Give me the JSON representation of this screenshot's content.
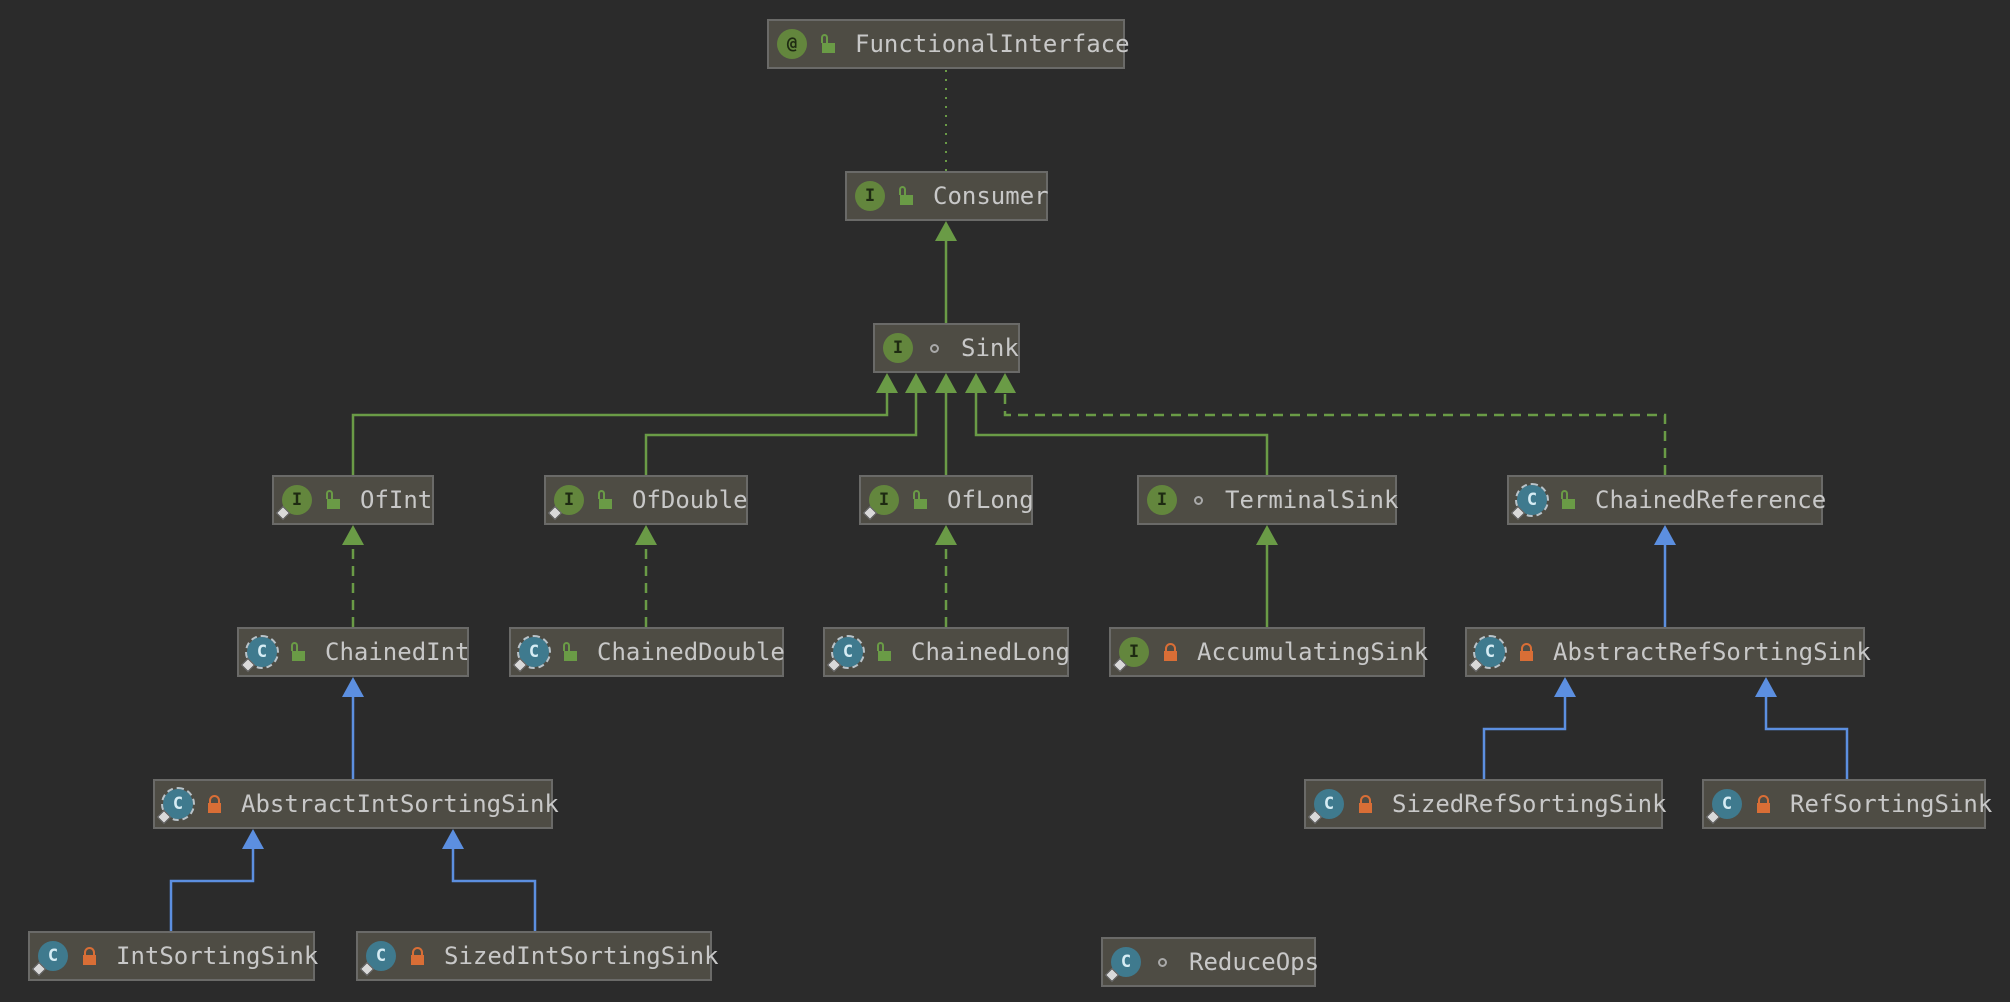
{
  "diagram": {
    "nodes": [
      {
        "id": "FunctionalInterface",
        "label": "FunctionalInterface",
        "kind": "@",
        "kind_type": "annotation",
        "abstract": false,
        "pin": false,
        "visibility": "public"
      },
      {
        "id": "Consumer",
        "label": "Consumer",
        "kind": "I",
        "kind_type": "interface",
        "abstract": false,
        "pin": false,
        "visibility": "public"
      },
      {
        "id": "Sink",
        "label": "Sink",
        "kind": "I",
        "kind_type": "interface",
        "abstract": false,
        "pin": false,
        "visibility": "package"
      },
      {
        "id": "OfInt",
        "label": "OfInt",
        "kind": "I",
        "kind_type": "interface",
        "abstract": false,
        "pin": true,
        "visibility": "public"
      },
      {
        "id": "OfDouble",
        "label": "OfDouble",
        "kind": "I",
        "kind_type": "interface",
        "abstract": false,
        "pin": true,
        "visibility": "public"
      },
      {
        "id": "OfLong",
        "label": "OfLong",
        "kind": "I",
        "kind_type": "interface",
        "abstract": false,
        "pin": true,
        "visibility": "public"
      },
      {
        "id": "TerminalSink",
        "label": "TerminalSink",
        "kind": "I",
        "kind_type": "interface",
        "abstract": false,
        "pin": false,
        "visibility": "package"
      },
      {
        "id": "ChainedReference",
        "label": "ChainedReference",
        "kind": "C",
        "kind_type": "class",
        "abstract": true,
        "pin": true,
        "visibility": "public"
      },
      {
        "id": "ChainedInt",
        "label": "ChainedInt",
        "kind": "C",
        "kind_type": "class",
        "abstract": true,
        "pin": true,
        "visibility": "public"
      },
      {
        "id": "ChainedDouble",
        "label": "ChainedDouble",
        "kind": "C",
        "kind_type": "class",
        "abstract": true,
        "pin": true,
        "visibility": "public"
      },
      {
        "id": "ChainedLong",
        "label": "ChainedLong",
        "kind": "C",
        "kind_type": "class",
        "abstract": true,
        "pin": true,
        "visibility": "public"
      },
      {
        "id": "AccumulatingSink",
        "label": "AccumulatingSink",
        "kind": "I",
        "kind_type": "interface",
        "abstract": false,
        "pin": true,
        "visibility": "private"
      },
      {
        "id": "AbstractRefSortingSink",
        "label": "AbstractRefSortingSink",
        "kind": "C",
        "kind_type": "class",
        "abstract": true,
        "pin": true,
        "visibility": "private"
      },
      {
        "id": "AbstractIntSortingSink",
        "label": "AbstractIntSortingSink",
        "kind": "C",
        "kind_type": "class",
        "abstract": true,
        "pin": true,
        "visibility": "private"
      },
      {
        "id": "SizedRefSortingSink",
        "label": "SizedRefSortingSink",
        "kind": "C",
        "kind_type": "class",
        "abstract": false,
        "pin": true,
        "visibility": "private"
      },
      {
        "id": "RefSortingSink",
        "label": "RefSortingSink",
        "kind": "C",
        "kind_type": "class",
        "abstract": false,
        "pin": true,
        "visibility": "private"
      },
      {
        "id": "IntSortingSink",
        "label": "IntSortingSink",
        "kind": "C",
        "kind_type": "class",
        "abstract": false,
        "pin": true,
        "visibility": "private"
      },
      {
        "id": "SizedIntSortingSink",
        "label": "SizedIntSortingSink",
        "kind": "C",
        "kind_type": "class",
        "abstract": false,
        "pin": true,
        "visibility": "private"
      },
      {
        "id": "ReduceOps",
        "label": "ReduceOps",
        "kind": "C",
        "kind_type": "class",
        "abstract": false,
        "pin": true,
        "visibility": "package"
      }
    ],
    "edges": [
      {
        "from": "Consumer",
        "to": "FunctionalInterface",
        "relation": "annotated-by"
      },
      {
        "from": "Sink",
        "to": "Consumer",
        "relation": "extends"
      },
      {
        "from": "OfInt",
        "to": "Sink",
        "relation": "extends"
      },
      {
        "from": "OfDouble",
        "to": "Sink",
        "relation": "extends"
      },
      {
        "from": "OfLong",
        "to": "Sink",
        "relation": "extends"
      },
      {
        "from": "TerminalSink",
        "to": "Sink",
        "relation": "extends"
      },
      {
        "from": "ChainedReference",
        "to": "Sink",
        "relation": "implements"
      },
      {
        "from": "ChainedInt",
        "to": "OfInt",
        "relation": "implements"
      },
      {
        "from": "ChainedDouble",
        "to": "OfDouble",
        "relation": "implements"
      },
      {
        "from": "ChainedLong",
        "to": "OfLong",
        "relation": "implements"
      },
      {
        "from": "AccumulatingSink",
        "to": "TerminalSink",
        "relation": "extends"
      },
      {
        "from": "AbstractRefSortingSink",
        "to": "ChainedReference",
        "relation": "class-extends"
      },
      {
        "from": "AbstractIntSortingSink",
        "to": "ChainedInt",
        "relation": "class-extends"
      },
      {
        "from": "SizedRefSortingSink",
        "to": "AbstractRefSortingSink",
        "relation": "class-extends"
      },
      {
        "from": "RefSortingSink",
        "to": "AbstractRefSortingSink",
        "relation": "class-extends"
      },
      {
        "from": "IntSortingSink",
        "to": "AbstractIntSortingSink",
        "relation": "class-extends"
      },
      {
        "from": "SizedIntSortingSink",
        "to": "AbstractIntSortingSink",
        "relation": "class-extends"
      }
    ],
    "colors": {
      "background": "#2b2b2b",
      "node_fill": "#4e4c44",
      "node_border": "#6a6a68",
      "text": "#c8c8c8",
      "interface_edge": "#6a9b46",
      "class_edge": "#5c8fe0",
      "annotation_edge": "#6a9b46",
      "open_lock": "#6a9b46",
      "closed_lock": "#d96e36"
    }
  }
}
